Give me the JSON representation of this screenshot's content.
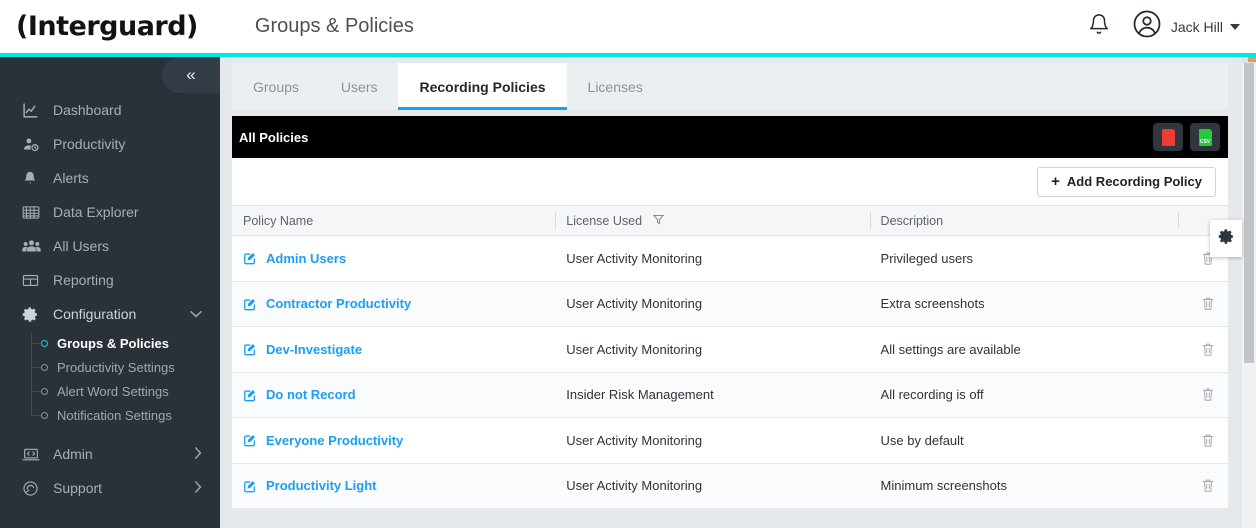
{
  "header": {
    "logo_text": "(Interguard)",
    "page_title": "Groups & Policies",
    "bell_icon": "bell-icon",
    "avatar_icon": "user-avatar-icon",
    "user_name": "Jack Hill",
    "caret_icon": "chevron-down-icon",
    "accent_color": "#00e5e5"
  },
  "sidebar": {
    "collapse_label": "«",
    "items": [
      {
        "label": "Dashboard",
        "icon": "chart-line-icon"
      },
      {
        "label": "Productivity",
        "icon": "person-clock-icon"
      },
      {
        "label": "Alerts",
        "icon": "bell-icon"
      },
      {
        "label": "Data Explorer",
        "icon": "keyboard-grid-icon"
      },
      {
        "label": "All Users",
        "icon": "users-group-icon"
      },
      {
        "label": "Reporting",
        "icon": "table-icon"
      },
      {
        "label": "Configuration",
        "icon": "gear-icon",
        "chevron": "chevron-down-icon",
        "expanded": true
      }
    ],
    "subitems": [
      {
        "label": "Groups & Policies",
        "active": true
      },
      {
        "label": "Productivity Settings",
        "active": false
      },
      {
        "label": "Alert Word Settings",
        "active": false
      },
      {
        "label": "Notification Settings",
        "active": false
      }
    ],
    "footer_items": [
      {
        "label": "Admin",
        "icon": "laptop-code-icon",
        "chevron": "chevron-right-icon"
      },
      {
        "label": "Support",
        "icon": "headset-icon",
        "chevron": "chevron-right-icon"
      }
    ],
    "active_dot_color": "#00d9e0"
  },
  "tabs": [
    {
      "label": "Groups",
      "active": false
    },
    {
      "label": "Users",
      "active": false
    },
    {
      "label": "Recording Policies",
      "active": true
    },
    {
      "label": "Licenses",
      "active": false
    }
  ],
  "panel": {
    "title": "All Policies",
    "export_pdf": {
      "icon": "pdf-file-icon",
      "label": "PDF",
      "color": "#ef3b35"
    },
    "export_csv": {
      "icon": "csv-file-icon",
      "label": "CSV",
      "color": "#27c840"
    },
    "add_button": {
      "plus": "+",
      "label": "Add Recording Policy"
    }
  },
  "table": {
    "columns": [
      {
        "label": "Policy Name",
        "filter": false
      },
      {
        "label": "License Used",
        "filter": true,
        "filter_icon": "filter-funnel-icon"
      },
      {
        "label": "Description",
        "filter": false
      },
      {
        "label": "",
        "filter": false
      }
    ],
    "rows": [
      {
        "name": "Admin Users",
        "license": "User Activity Monitoring",
        "description": "Privileged users"
      },
      {
        "name": "Contractor Productivity",
        "license": "User Activity Monitoring",
        "description": "Extra screenshots"
      },
      {
        "name": "Dev-Investigate",
        "license": "User Activity Monitoring",
        "description": "All settings are available"
      },
      {
        "name": "Do not Record",
        "license": "Insider Risk Management",
        "description": "All recording is off"
      },
      {
        "name": "Everyone Productivity",
        "license": "User Activity Monitoring",
        "description": "Use by default"
      },
      {
        "name": "Productivity Light",
        "license": "User Activity Monitoring",
        "description": "Minimum screenshots"
      }
    ],
    "row_edit_icon": "edit-square-icon",
    "row_delete_icon": "trash-icon",
    "link_color": "#1b9ef3"
  },
  "floating": {
    "gear_icon": "gear-settings-icon"
  }
}
